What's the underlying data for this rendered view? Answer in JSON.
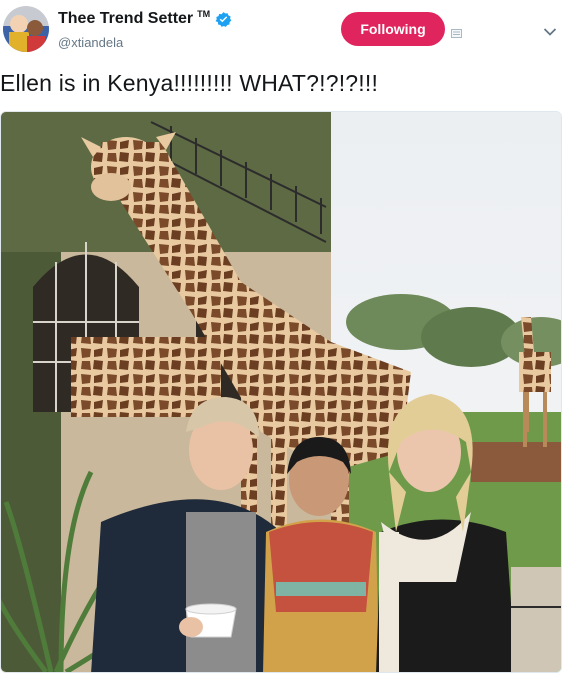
{
  "header": {
    "display_name": "Thee Trend Setter",
    "tm": "TM",
    "handle": "@xtiandela",
    "follow_label": "Following"
  },
  "tweet": {
    "text": "Ellen is in Kenya!!!!!!!!! WHAT?!?!?!!!"
  },
  "icons": {
    "verified": "verified-badge-icon",
    "block": "block-icon",
    "more": "chevron-down-icon"
  },
  "colors": {
    "follow_button": "#e0245e",
    "verified": "#1da1f2",
    "handle": "#657786"
  }
}
